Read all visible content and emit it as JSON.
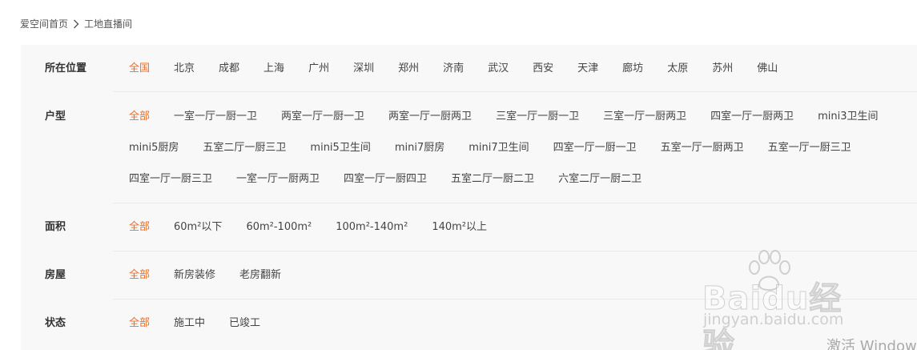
{
  "breadcrumb": {
    "home": "爱空间首页",
    "current": "工地直播间"
  },
  "filters": {
    "location": {
      "label": "所在位置",
      "options": [
        "全国",
        "北京",
        "成都",
        "上海",
        "广州",
        "深圳",
        "郑州",
        "济南",
        "武汉",
        "西安",
        "天津",
        "廊坊",
        "太原",
        "苏州",
        "佛山"
      ],
      "selected": "全国"
    },
    "layout": {
      "label": "户型",
      "options": [
        "全部",
        "一室一厅一厨一卫",
        "两室一厅一厨一卫",
        "两室一厅一厨两卫",
        "三室一厅一厨一卫",
        "三室一厅一厨两卫",
        "四室一厅一厨两卫",
        "mini3卫生间",
        "mini5厨房",
        "五室二厅一厨三卫",
        "mini5卫生间",
        "mini7厨房",
        "mini7卫生间",
        "四室一厅一厨一卫",
        "五室一厅一厨两卫",
        "五室一厅一厨三卫",
        "四室一厅一厨三卫",
        "一室一厅一厨两卫",
        "四室一厅一厨四卫",
        "五室二厅一厨二卫",
        "六室二厅一厨二卫"
      ],
      "selected": "全部"
    },
    "area": {
      "label": "面积",
      "options": [
        "全部",
        "60m²以下",
        "60m²-100m²",
        "100m²-140m²",
        "140m²以上"
      ],
      "selected": "全部"
    },
    "house": {
      "label": "房屋",
      "options": [
        "全部",
        "新房装修",
        "老房翻新"
      ],
      "selected": "全部"
    },
    "status": {
      "label": "状态",
      "options": [
        "全部",
        "施工中",
        "已竣工"
      ],
      "selected": "全部"
    }
  },
  "overlay": {
    "watermark_brand": "Baidu经验",
    "watermark_url": "jingyan.baidu.com",
    "activate_windows": "激活 Windows"
  },
  "colors": {
    "accent": "#f26b1d",
    "panel_bg": "#f8f8f8"
  }
}
